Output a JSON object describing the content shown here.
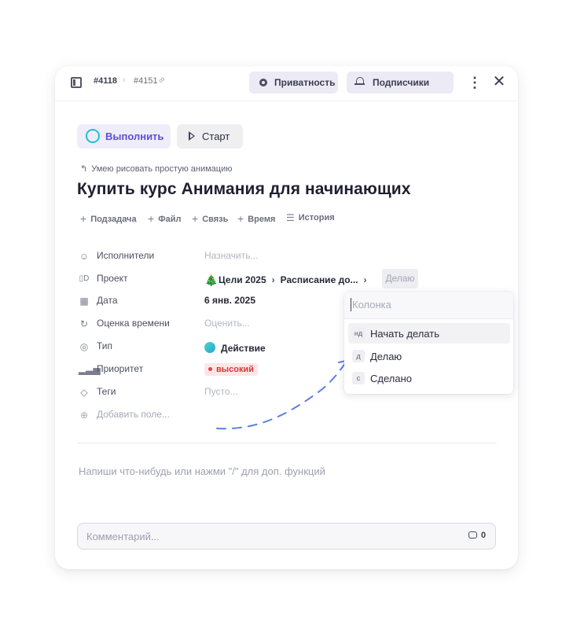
{
  "topbar": {
    "task_id": "#4118",
    "parent_id": "#4151",
    "privacy_label": "Приватность",
    "subscribers_label": "Подписчики"
  },
  "buttons": {
    "complete_label": "Выполнить",
    "start_label": "Старт"
  },
  "parent_task": "Умею рисовать простую анимацию",
  "title": "Купить курс Анимания для начинающих",
  "actions": [
    {
      "label": "Подзадача",
      "icon": "plus-icon"
    },
    {
      "label": "Файл",
      "icon": "plus-icon"
    },
    {
      "label": "Связь",
      "icon": "plus-icon"
    },
    {
      "label": "Время",
      "icon": "plus-icon"
    },
    {
      "label": "История",
      "icon": "list-icon"
    }
  ],
  "properties": {
    "assignees": {
      "label": "Исполнители",
      "value": "Назначить..."
    },
    "project": {
      "label": "Проект",
      "goal": "Цели 2025",
      "board": "Расписание до...",
      "column": "Делаю"
    },
    "date": {
      "label": "Дата",
      "value": "6 янв. 2025"
    },
    "estimate": {
      "label": "Оценка времени",
      "value": "Оценить..."
    },
    "type": {
      "label": "Тип",
      "value": "Действие"
    },
    "priority": {
      "label": "Приоритет",
      "value": "высокий",
      "color": "#d23a3a"
    },
    "tags": {
      "label": "Теги",
      "value": "Пусто..."
    },
    "add_field": "Добавить поле..."
  },
  "editor_placeholder": "Напиши что-нибудь или нажми \"/\" для доп. функций",
  "comment": {
    "placeholder": "Комментарий...",
    "count": "0"
  },
  "column_dropdown": {
    "placeholder": "Колонка",
    "options": [
      {
        "key": "нд",
        "label": "Начать делать",
        "active": true
      },
      {
        "key": "д",
        "label": "Делаю",
        "active": false
      },
      {
        "key": "с",
        "label": "Сделано",
        "active": false
      }
    ]
  },
  "colors": {
    "accent": "#5b4fd6",
    "complete_ring": "#1fc1cf",
    "annotation_arrow": "#5b7fe0"
  }
}
